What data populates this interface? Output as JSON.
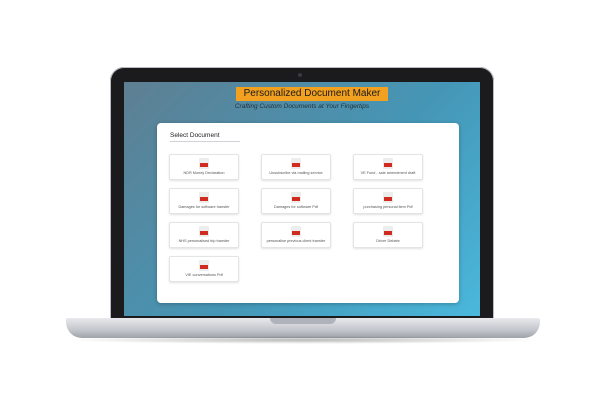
{
  "app": {
    "title": "Personalized Document Maker",
    "subtitle": "Crafting Custom Documents at Your Fingertips"
  },
  "panel": {
    "select_label": "Select Document"
  },
  "documents": [
    {
      "label": "NDR Money Declaration",
      "icon": "pdf-file-icon"
    },
    {
      "label": "Unsubscribe via mailing service",
      "icon": "pdf-file-icon"
    },
    {
      "label": "VE Fund - sale amendment draft",
      "icon": "pdf-file-icon"
    },
    {
      "label": "Damages for software transfer",
      "icon": "pdf-file-icon"
    },
    {
      "label": "Damages for software Pdf",
      "icon": "pdf-file-icon"
    },
    {
      "label": "purchasing personal item Pdf",
      "icon": "pdf-file-icon"
    },
    {
      "label": "NHS personalised trip transfer",
      "icon": "pdf-file-icon"
    },
    {
      "label": "personalise previous client transfer",
      "icon": "pdf-file-icon"
    },
    {
      "label": "Driver Debate",
      "icon": "pdf-file-icon"
    },
    {
      "label": "VIE conversations Pdf",
      "icon": "pdf-file-icon"
    }
  ],
  "colors": {
    "title_background": "#f2a01f",
    "file_tag": "#d12a1e",
    "screen_gradient_start": "#5e7f92",
    "screen_gradient_end": "#4ab8dc"
  }
}
